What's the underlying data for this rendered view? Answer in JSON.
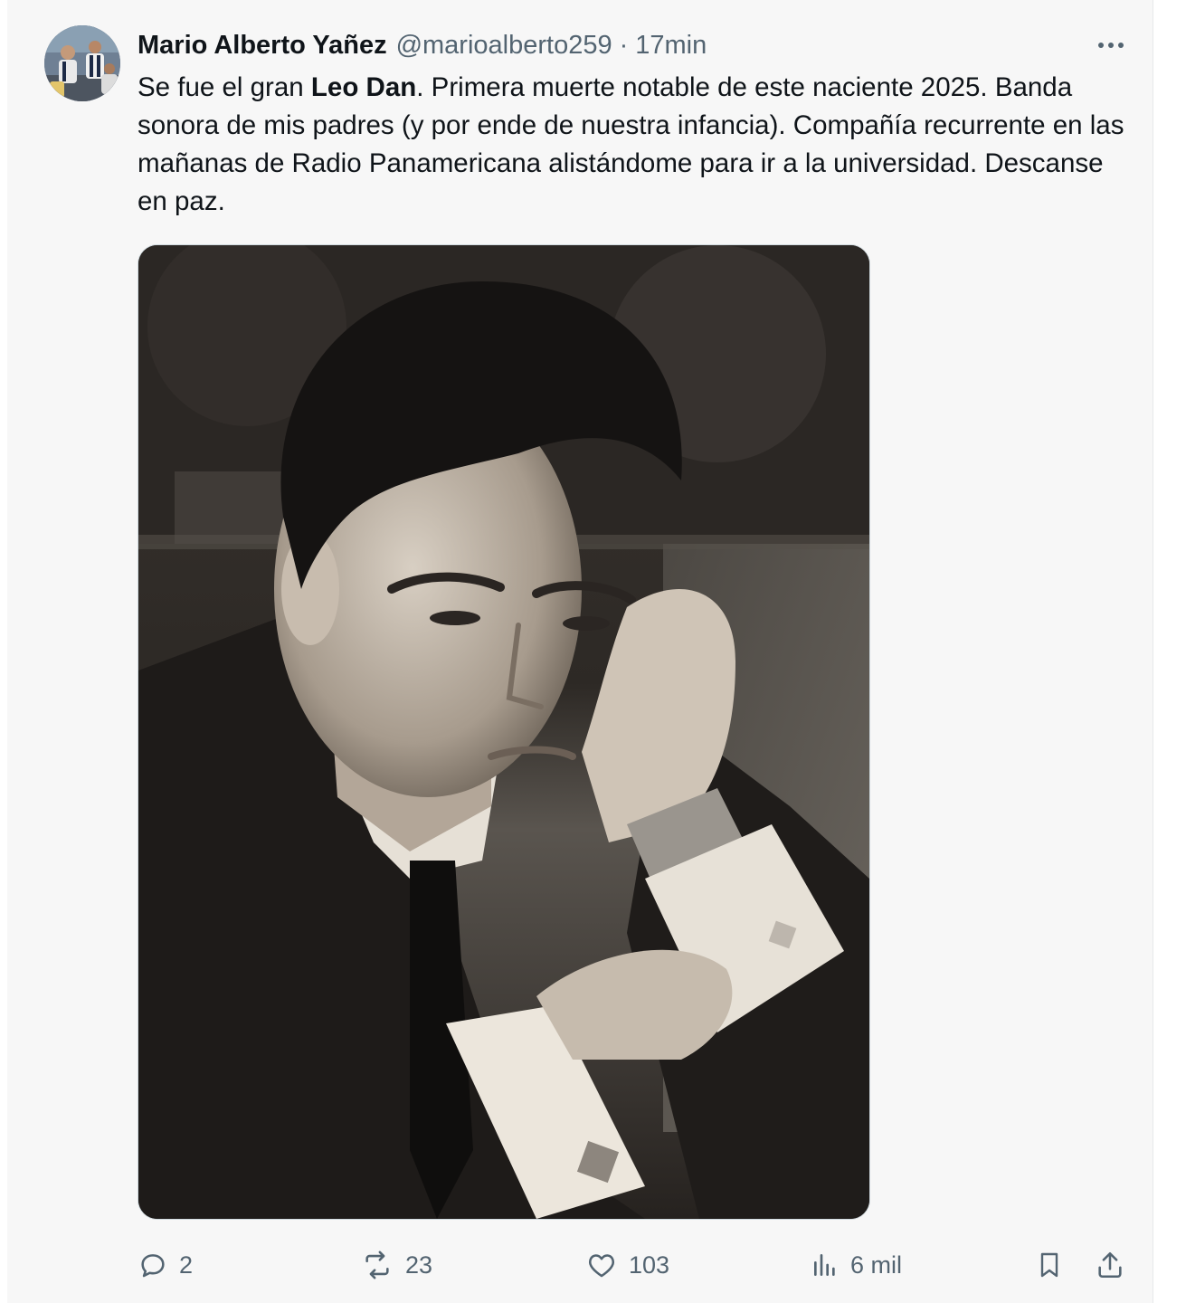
{
  "tweet": {
    "author": {
      "display_name": "Mario Alberto Yañez",
      "handle": "@marioalberto259"
    },
    "separator": "·",
    "timestamp": "17min",
    "text": {
      "part1": "Se fue el gran ",
      "bold": "Leo Dan",
      "part2": ". Primera muerte notable de este naciente 2025. Banda sonora de mis padres (y por ende de nuestra infancia). Compañía recurrente en las mañanas de Radio Panamericana alistándome para ir a la universidad. Descanse en paz."
    },
    "media": {
      "kind": "black-and-white portrait photo"
    },
    "actions": {
      "replies": "2",
      "reposts": "23",
      "likes": "103",
      "views": "6 mil"
    }
  },
  "icons": [
    "more-icon",
    "reply-icon",
    "repost-icon",
    "like-icon",
    "views-icon",
    "bookmark-icon",
    "share-icon"
  ],
  "colors": {
    "text_primary": "#0f1419",
    "text_secondary": "#536471",
    "card_background": "#f7f7f7",
    "border": "#cfd9de"
  }
}
